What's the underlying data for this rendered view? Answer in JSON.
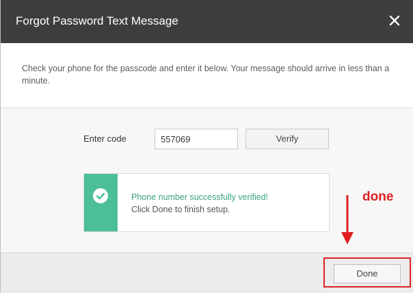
{
  "dialog": {
    "title": "Forgot Password Text Message",
    "close_icon": "close-icon"
  },
  "instructions": {
    "text": "Check your phone for the passcode and enter it below. Your message should arrive in less than a minute."
  },
  "code_form": {
    "label": "Enter code",
    "value": "557069",
    "verify_label": "Verify"
  },
  "success": {
    "icon": "check-circle-icon",
    "line1": "Phone number successfully verified!",
    "line2": "Click Done to finish setup."
  },
  "footer": {
    "done_label": "Done"
  },
  "annotation": {
    "text": "done",
    "arrow_icon": "down-arrow-icon"
  },
  "colors": {
    "header_bg": "#3d3d3d",
    "success_green": "#4cbf9a",
    "annotation_red": "#e02020"
  }
}
